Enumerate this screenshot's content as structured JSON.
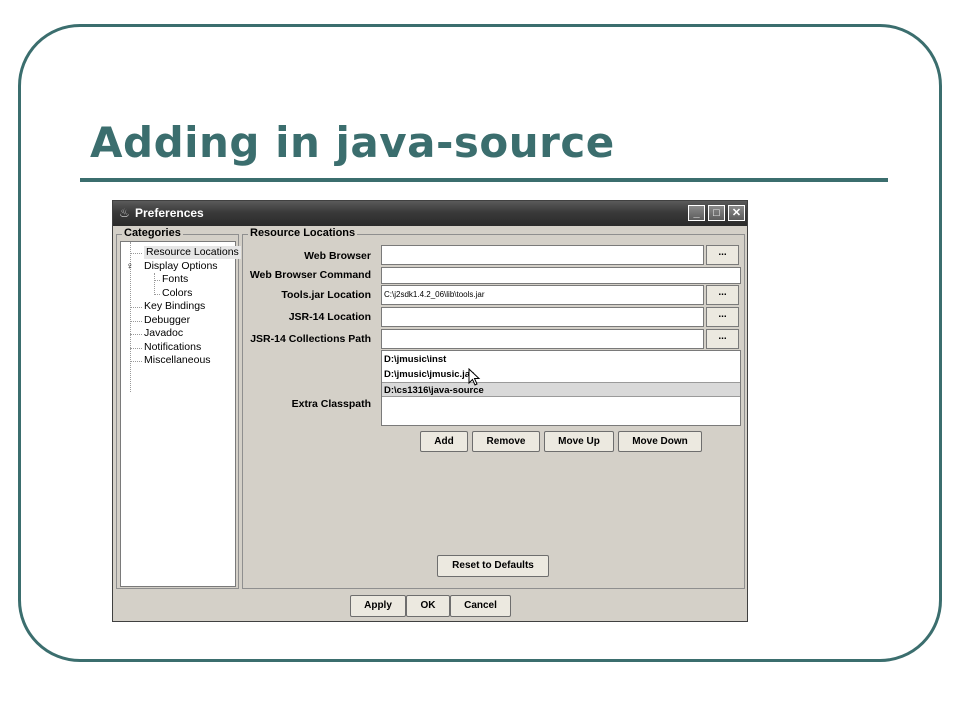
{
  "slide": {
    "title": "Adding in java-source",
    "accent_color": "#3b6e6e"
  },
  "window": {
    "title": "Preferences",
    "icon": "java-cup-icon",
    "controls": {
      "minimize": "_",
      "maximize": "□",
      "close": "✕"
    }
  },
  "categories": {
    "label": "Categories",
    "items": [
      "Resource Locations",
      "Display Options",
      "Fonts",
      "Colors",
      "Key Bindings",
      "Debugger",
      "Javadoc",
      "Notifications",
      "Miscellaneous"
    ],
    "selected": "Resource Locations"
  },
  "resource_locations": {
    "label": "Resource Locations",
    "web_browser": {
      "label": "Web Browser",
      "value": ""
    },
    "web_browser_command": {
      "label": "Web Browser Command",
      "value": ""
    },
    "tools_jar": {
      "label": "Tools.jar Location",
      "value": "C:\\j2sdk1.4.2_06\\lib\\tools.jar"
    },
    "jsr14_location": {
      "label": "JSR-14 Location",
      "value": ""
    },
    "jsr14_collections": {
      "label": "JSR-14 Collections Path",
      "value": ""
    },
    "extra_classpath": {
      "label": "Extra Classpath",
      "items": [
        "D:\\jmusic\\inst",
        "D:\\jmusic\\jmusic.jar",
        "D:\\cs1316\\java-source"
      ],
      "selected_index": 2
    },
    "browse_label": "...",
    "buttons": {
      "add": "Add",
      "remove": "Remove",
      "move_up": "Move Up",
      "move_down": "Move Down"
    },
    "reset": "Reset to Defaults"
  },
  "footer": {
    "apply": "Apply",
    "ok": "OK",
    "cancel": "Cancel"
  }
}
